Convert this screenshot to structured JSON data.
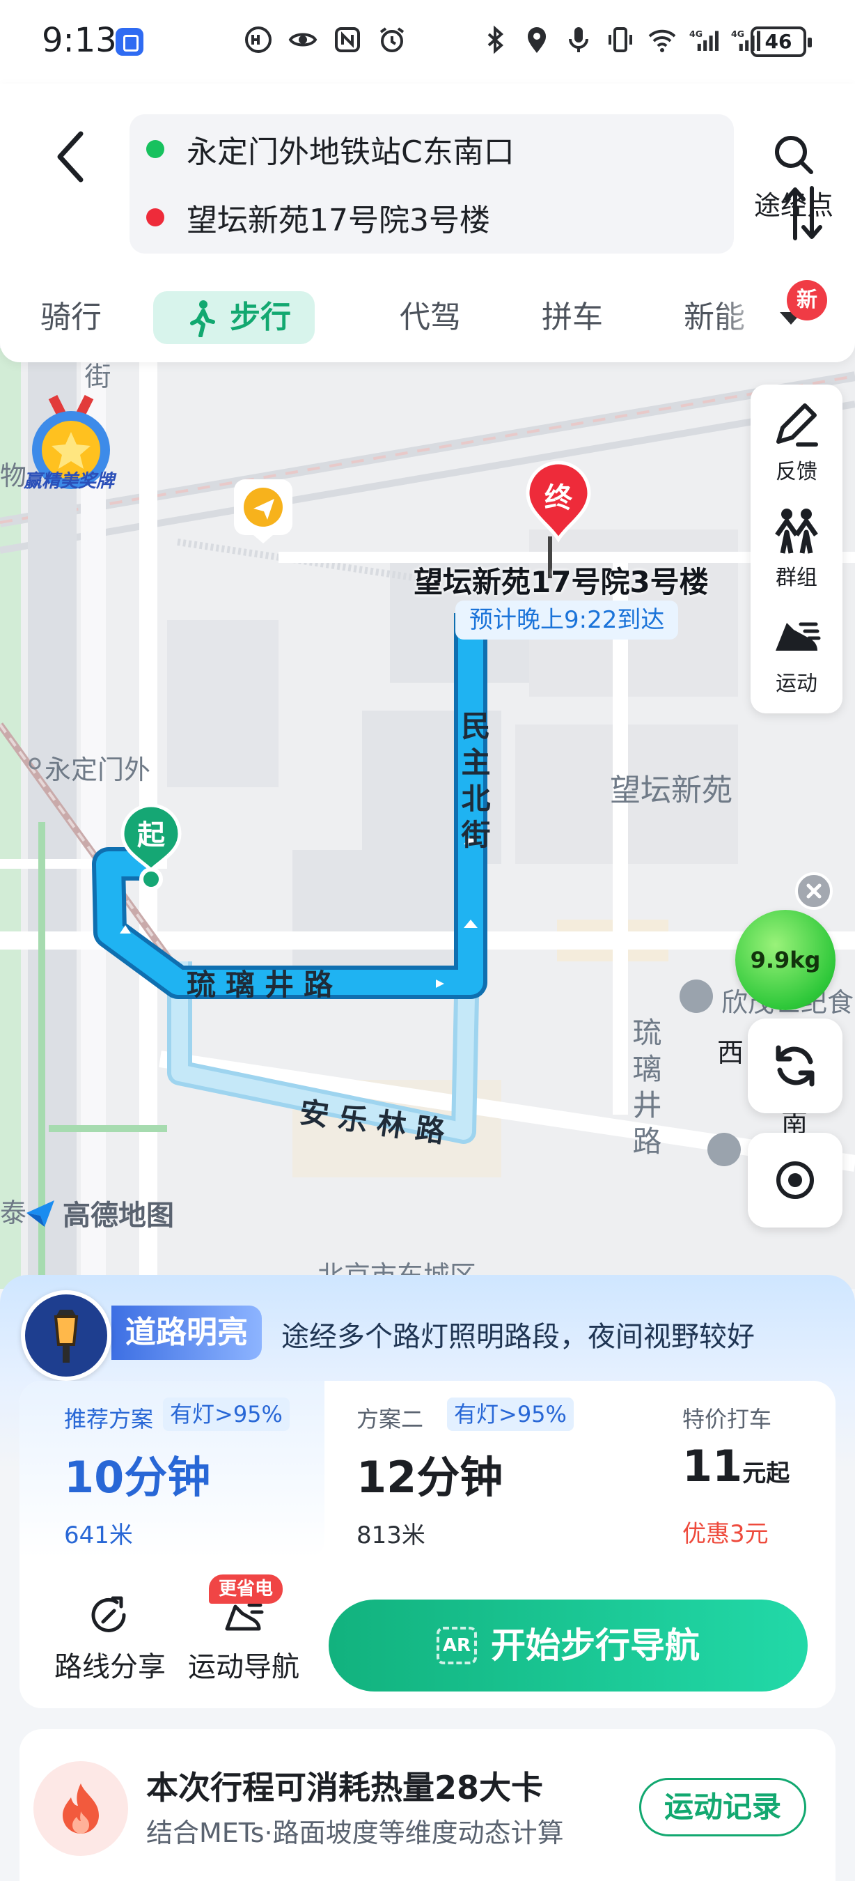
{
  "status_bar": {
    "time": "9:13",
    "battery": "46",
    "icons": [
      "app-badge-icon",
      "hd-icon",
      "eye-icon",
      "nfc-icon",
      "alarm-icon",
      "bluetooth-icon",
      "location-icon",
      "mic-icon",
      "vibrate-icon",
      "wifi-icon",
      "signal-4g-icon",
      "signal-4g-icon"
    ]
  },
  "route": {
    "start": "永定门外地铁站C东南口",
    "end": "望坛新苑17号院3号楼",
    "waypoint_label": "途经点"
  },
  "tabs": [
    {
      "label": "骑行"
    },
    {
      "label": "步行",
      "active": true
    },
    {
      "label": "代驾"
    },
    {
      "label": "拼车"
    },
    {
      "label": "新能"
    }
  ],
  "tab_new_badge": "新",
  "map": {
    "medal_text": "赢精美奖牌",
    "place_labels": {
      "yongdingmenwai": "永定门外",
      "wangtan": "望坛新苑",
      "dongcheng": "北京市东城区",
      "xinjin": "欣茂世纪食",
      "wu": "物",
      "tai": "泰",
      "xi": "西",
      "nan": "南",
      "jie": "街"
    },
    "roads": {
      "liulijing": "琉璃井路",
      "minzhubei": "民主北街",
      "anlelin": "安乐林路",
      "liulijing_vertical": "琉璃井路"
    },
    "start_pin": "起",
    "end_pin": "终",
    "destination_name": "望坛新苑17号院3号楼",
    "eta": "预计晚上9:22到达",
    "tools": [
      {
        "label": "反馈",
        "icon": "edit-icon"
      },
      {
        "label": "群组",
        "icon": "group-icon"
      },
      {
        "label": "运动",
        "icon": "running-shoe-icon"
      }
    ],
    "carbon": "9.9kg",
    "logo": "高德地图"
  },
  "sheet": {
    "road_tag": "道路明亮",
    "road_desc": "途经多个路灯照明路段，夜间视野较好",
    "plans": [
      {
        "name": "推荐方案",
        "light": "有灯>95%",
        "time": "10分钟",
        "distance": "641米"
      },
      {
        "name": "方案二",
        "light": "有灯>95%",
        "time": "12分钟",
        "distance": "813米"
      }
    ],
    "taxi": {
      "name": "特价打车",
      "price": "11",
      "unit": "元起",
      "discount": "优惠3元"
    },
    "actions": {
      "share": "路线分享",
      "sport_nav": "运动导航",
      "save_badge": "更省电",
      "start": "开始步行导航",
      "ar": "AR"
    },
    "calorie": {
      "title": "本次行程可消耗热量28大卡",
      "subtitle": "结合METs·路面坡度等维度动态计算",
      "button": "运动记录"
    }
  },
  "colors": {
    "accent": "#12a870",
    "route": "#1aa3ee",
    "alt_route": "#a8dcf5",
    "blue": "#2867d6",
    "red": "#ee2b3a"
  }
}
